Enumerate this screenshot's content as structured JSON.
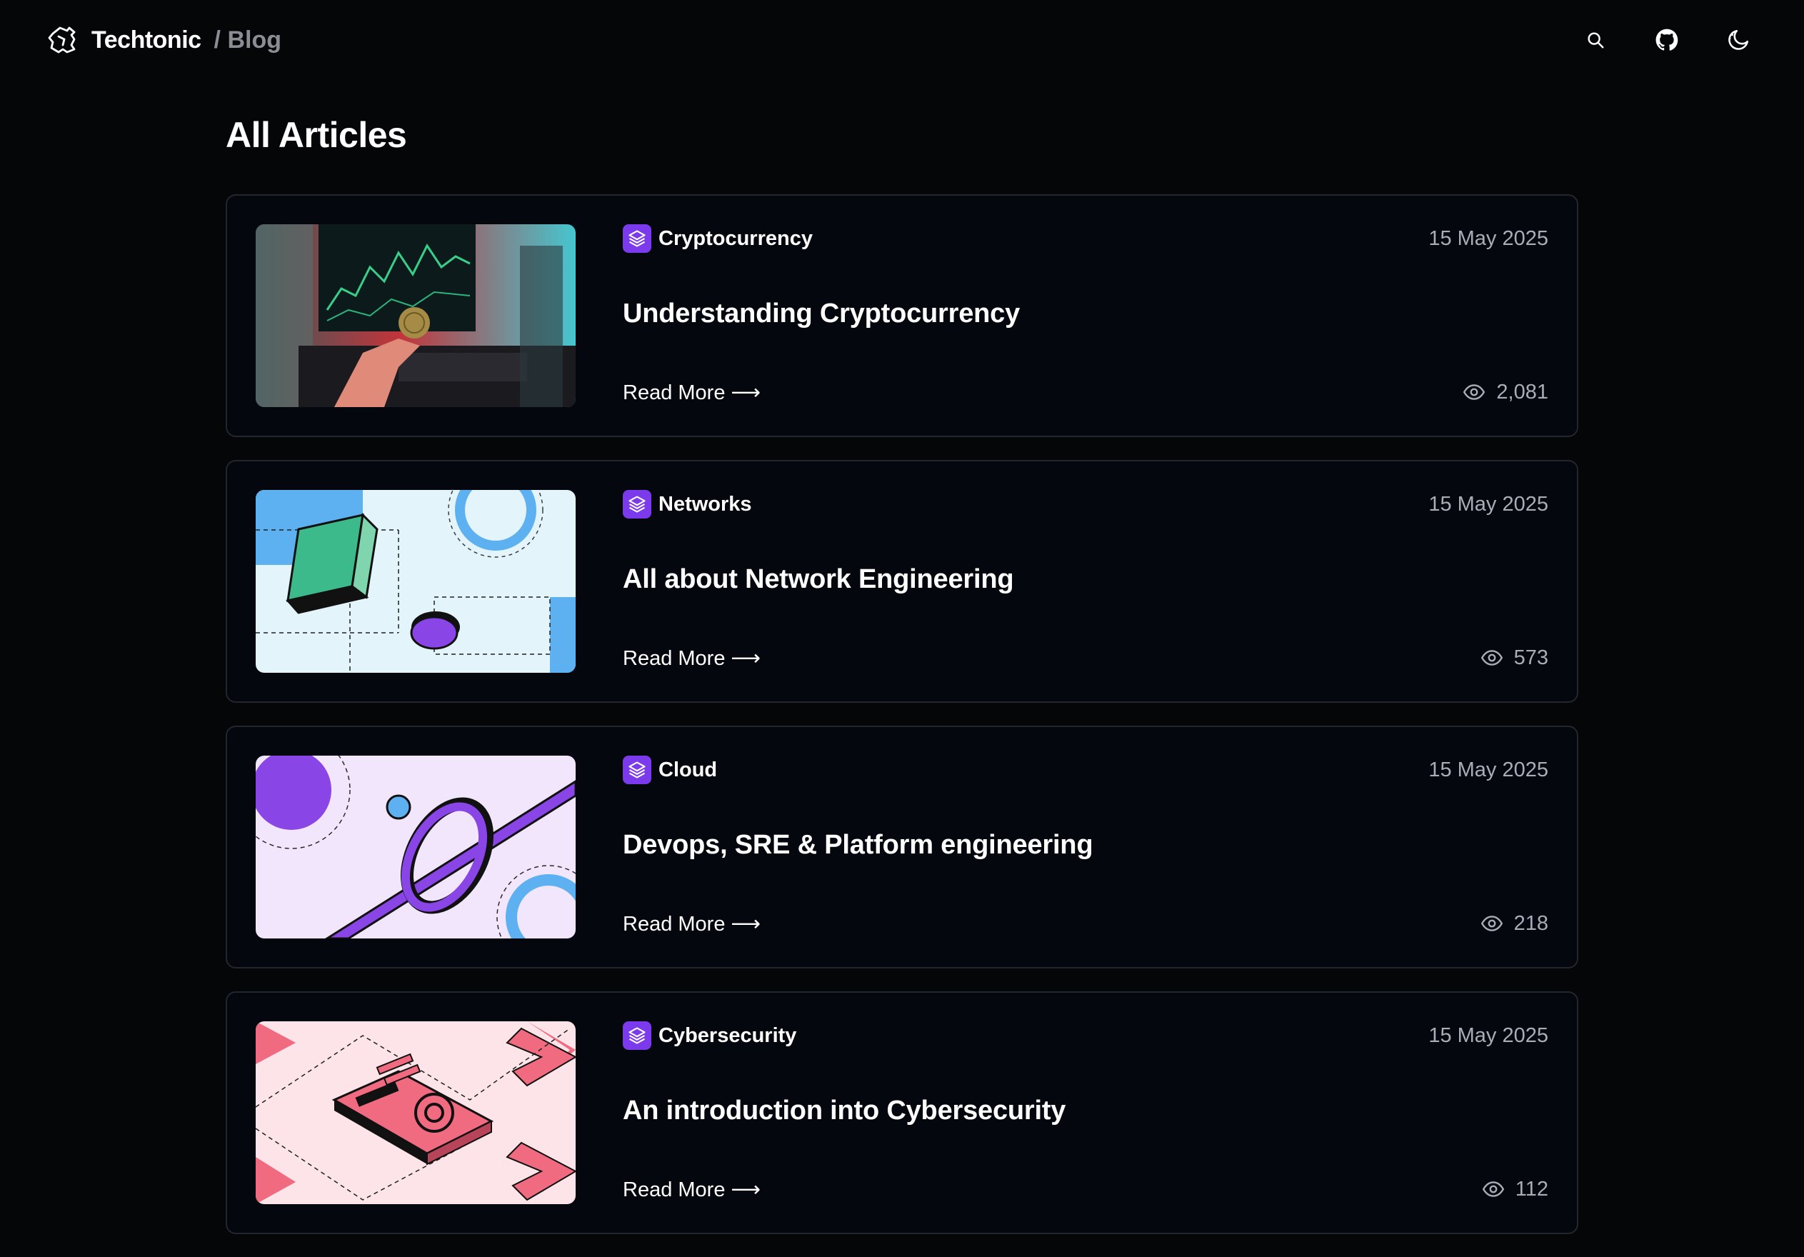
{
  "header": {
    "brand": "Techtonic",
    "section": "/ Blog",
    "icons": {
      "logo": "puzzle-logo-icon",
      "search": "search-icon",
      "github": "github-icon",
      "theme": "moon-icon"
    }
  },
  "page": {
    "title": "All Articles"
  },
  "articles": [
    {
      "category": "Cryptocurrency",
      "date": "15 May 2025",
      "title": "Understanding Cryptocurrency",
      "read_more": "Read More ⟶",
      "views": "2,081",
      "thumbnail": "crypto-trading-photo"
    },
    {
      "category": "Networks",
      "date": "15 May 2025",
      "title": "All about Network Engineering",
      "read_more": "Read More ⟶",
      "views": "573",
      "thumbnail": "network-illustration"
    },
    {
      "category": "Cloud",
      "date": "15 May 2025",
      "title": "Devops, SRE & Platform engineering",
      "read_more": "Read More ⟶",
      "views": "218",
      "thumbnail": "cloud-illustration"
    },
    {
      "category": "Cybersecurity",
      "date": "15 May 2025",
      "title": "An introduction into Cybersecurity",
      "read_more": "Read More ⟶",
      "views": "112",
      "thumbnail": "cybersecurity-illustration"
    }
  ],
  "colors": {
    "background": "#050608",
    "card_border": "#23262d",
    "category_badge": "#7c3aed",
    "muted_text": "#a9adb5"
  }
}
